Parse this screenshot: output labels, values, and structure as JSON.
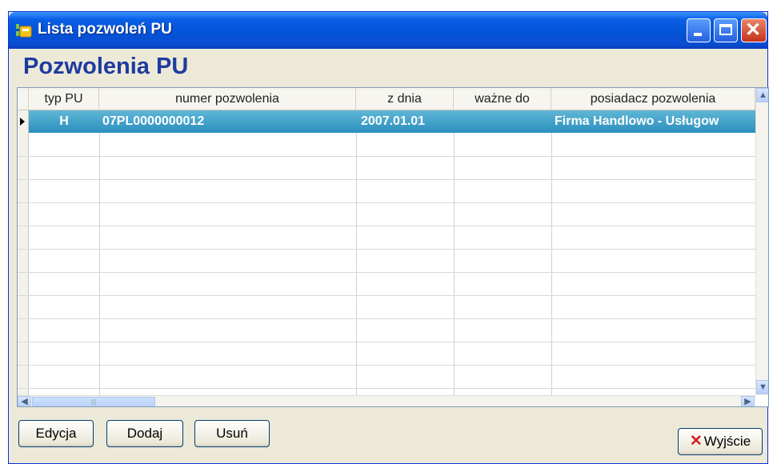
{
  "window": {
    "title": "Lista pozwoleń PU"
  },
  "section_title": "Pozwolenia PU",
  "table": {
    "columns": [
      "typ PU",
      "numer pozwolenia",
      "z dnia",
      "ważne do",
      "posiadacz pozwolenia"
    ],
    "rows": [
      {
        "typ": "H",
        "numer": "07PL0000000012",
        "z_dnia": "2007.01.01",
        "wazne_do": "",
        "posiadacz": "Firma Handlowo - Usługow"
      }
    ],
    "selection_color": "#3399c6"
  },
  "buttons": {
    "edit": "Edycja",
    "add": "Dodaj",
    "delete": "Usuń",
    "exit": "Wyjście"
  },
  "icons": {
    "exit": "red-x-icon"
  },
  "colors": {
    "titlebar": "#0a5fe6",
    "section_title": "#1e3b9e",
    "window_bg": "#ece9d8"
  }
}
